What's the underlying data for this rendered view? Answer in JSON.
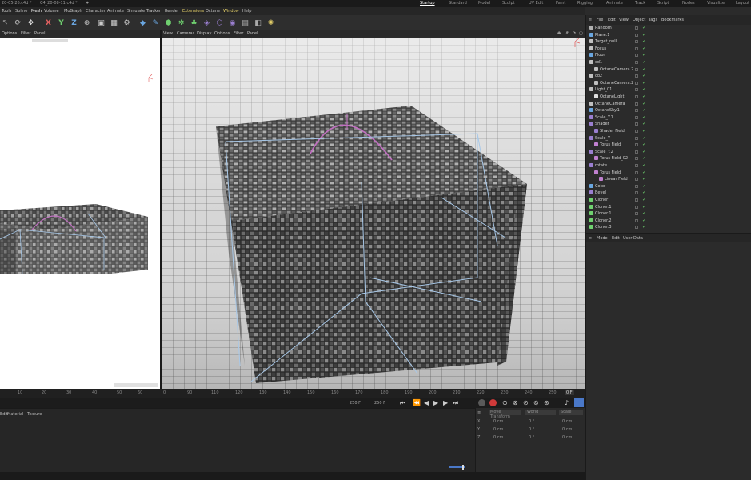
{
  "tabs": {
    "docs": [
      "20-05-26.c4d *",
      "C4_20-08-11.c4d *",
      "+"
    ],
    "workspaces": [
      {
        "label": "Startup",
        "active": true
      },
      {
        "label": "Standard"
      },
      {
        "label": "Model"
      },
      {
        "label": "Sculpt"
      },
      {
        "label": "UV Edit"
      },
      {
        "label": "Paint"
      },
      {
        "label": "Rigging"
      },
      {
        "label": "Animate"
      },
      {
        "label": "Track"
      },
      {
        "label": "Script"
      },
      {
        "label": "Nodes"
      },
      {
        "label": "Visualize"
      },
      {
        "label": "Layout"
      }
    ]
  },
  "menubar": [
    "Tools",
    "Spline",
    "Mesh",
    "Volume",
    "MoGraph",
    "Character",
    "Animate",
    "Simulate",
    "Tracker",
    "Render",
    "Extensions",
    "Octane",
    "Window",
    "Help"
  ],
  "left_view_menu": [
    "Options",
    "Filter",
    "Panel"
  ],
  "main_view_menu": [
    "View",
    "Cameras",
    "Display",
    "Options",
    "Filter",
    "Panel"
  ],
  "toolbar": {
    "axis_x": "X",
    "axis_y": "Y",
    "axis_z": "Z"
  },
  "object_manager": {
    "menu": [
      "File",
      "Edit",
      "View",
      "Object",
      "Tags",
      "Bookmarks"
    ],
    "objects": [
      {
        "name": "Random",
        "indent": 0,
        "icon": "#b0b0b0"
      },
      {
        "name": "Plane.1",
        "indent": 0,
        "icon": "#6aa6e0"
      },
      {
        "name": "Target_null",
        "indent": 0,
        "icon": "#c0c0c0"
      },
      {
        "name": "Focus",
        "indent": 0,
        "icon": "#c0c0c0"
      },
      {
        "name": "Floor",
        "indent": 0,
        "icon": "#6aa6e0"
      },
      {
        "name": "cd1",
        "indent": 0,
        "icon": "#c0c0c0"
      },
      {
        "name": "OctaneCamera.2",
        "indent": 1,
        "icon": "#c0c0c0"
      },
      {
        "name": "cd2",
        "indent": 0,
        "icon": "#c0c0c0"
      },
      {
        "name": "OctaneCamera.2",
        "indent": 1,
        "icon": "#c0c0c0"
      },
      {
        "name": "Light_01",
        "indent": 0,
        "icon": "#c0c0c0"
      },
      {
        "name": "OctaneLight",
        "indent": 1,
        "icon": "#e0e0e0"
      },
      {
        "name": "OctaneCamera",
        "indent": 0,
        "icon": "#c0c0c0"
      },
      {
        "name": "OctaneSky.1",
        "indent": 0,
        "icon": "#6aa6e0"
      },
      {
        "name": "Scale_Y.1",
        "indent": 0,
        "icon": "#9a7fd0"
      },
      {
        "name": "Shader",
        "indent": 0,
        "icon": "#9a7fd0"
      },
      {
        "name": "Shader Field",
        "indent": 1,
        "icon": "#9a7fd0"
      },
      {
        "name": "Scale_Y",
        "indent": 0,
        "icon": "#9a7fd0"
      },
      {
        "name": "Torus Field",
        "indent": 1,
        "icon": "#c080d0"
      },
      {
        "name": "Scale_Y.2",
        "indent": 0,
        "icon": "#9a7fd0"
      },
      {
        "name": "Torus Field_02",
        "indent": 1,
        "icon": "#c080d0"
      },
      {
        "name": "rotate",
        "indent": 0,
        "icon": "#9a7fd0"
      },
      {
        "name": "Torus Field",
        "indent": 1,
        "icon": "#c080d0"
      },
      {
        "name": "Linear Field",
        "indent": 2,
        "icon": "#c080d0"
      },
      {
        "name": "Color",
        "indent": 0,
        "icon": "#6aa6e0"
      },
      {
        "name": "Bevel",
        "indent": 0,
        "icon": "#9a7fd0"
      },
      {
        "name": "Cloner",
        "indent": 0,
        "icon": "#6fd06f"
      },
      {
        "name": "Cloner.1",
        "indent": 0,
        "icon": "#6fd06f"
      },
      {
        "name": "Cloner.1",
        "indent": 0,
        "icon": "#6fd06f"
      },
      {
        "name": "Cloner.2",
        "indent": 0,
        "icon": "#6fd06f"
      },
      {
        "name": "Cloner.3",
        "indent": 0,
        "icon": "#6fd06f"
      }
    ]
  },
  "attributes": {
    "menu": [
      "Mode",
      "Edit",
      "User Data"
    ]
  },
  "timeline": {
    "ticks_left": [
      "0",
      "10",
      "20",
      "30",
      "40",
      "50",
      "60",
      "70",
      "80",
      "90"
    ],
    "ticks_main": [
      "0",
      "10",
      "20",
      "30",
      "40",
      "50",
      "60",
      "70",
      "80",
      "90",
      "100",
      "110",
      "120",
      "130",
      "140",
      "150",
      "160",
      "170",
      "180",
      "190",
      "200",
      "210",
      "220",
      "230",
      "240",
      "250"
    ],
    "frame_end": "0 F",
    "start_field": "250 F",
    "end_field": "250 F"
  },
  "material_tabs": [
    "Edit",
    "Material",
    "Texture"
  ],
  "coordinates": {
    "headers": [
      "Move Transform",
      "World",
      "Scale"
    ],
    "rows": [
      {
        "axis": "X",
        "pos": "0 cm",
        "rot": "0 °",
        "scale": "0 cm"
      },
      {
        "axis": "Y",
        "pos": "0 cm",
        "rot": "0 °",
        "scale": "0 cm"
      },
      {
        "axis": "Z",
        "pos": "0 cm",
        "rot": "0 °",
        "scale": "0 cm"
      }
    ]
  },
  "colors": {
    "accent": "#4a78c8",
    "record": "#d03a3a",
    "check": "#6fd06f",
    "cage": "#a8c8e8",
    "arc": "#c070c0"
  }
}
